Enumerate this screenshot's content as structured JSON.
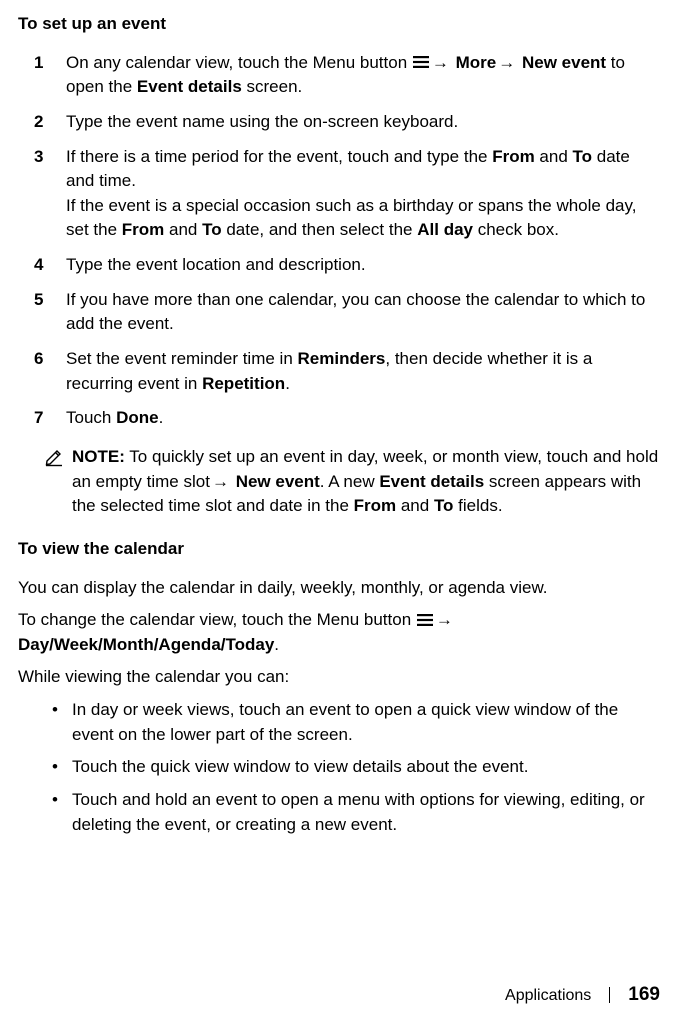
{
  "section1": {
    "heading": "To set up an event",
    "steps": [
      {
        "num": "1",
        "pre": "On any calendar view, touch the Menu button ",
        "arrow1": "→ ",
        "more": "More",
        "arrow2": "→ ",
        "newevent": "New event",
        "mid": " to open the ",
        "eventdetails": "Event details",
        "post": " screen."
      },
      {
        "num": "2",
        "text": "Type the event name using the on-screen keyboard."
      },
      {
        "num": "3",
        "p1a": "If there is a time period for the event, touch and type the ",
        "from": "From",
        "p1b": " and ",
        "to": "To",
        "p1c": " date and time.",
        "p2a": "If the event is a special occasion such as a birthday or spans the whole day, set the ",
        "from2": "From",
        "p2b": " and ",
        "to2": "To",
        "p2c": " date, and then select the ",
        "allday": "All day",
        "p2d": " check box."
      },
      {
        "num": "4",
        "text": "Type the event location and description."
      },
      {
        "num": "5",
        "text": "If you have more than one calendar, you can choose the calendar to which to add the event."
      },
      {
        "num": "6",
        "a": "Set the event reminder time in ",
        "reminders": "Reminders",
        "b": ", then decide whether it is a recurring event in ",
        "repetition": "Repetition",
        "c": "."
      },
      {
        "num": "7",
        "a": "Touch ",
        "done": "Done",
        "b": "."
      }
    ],
    "note": {
      "label": "NOTE:",
      "a": " To quickly set up an event in day, week, or month view, touch and hold an empty time slot",
      "arrow": "→ ",
      "newevent": "New event",
      "b": ". A new ",
      "eventdetails": "Event details",
      "c": " screen appears with the selected time slot and date in the ",
      "from": "From",
      "d": " and ",
      "to": "To",
      "e": " fields."
    }
  },
  "section2": {
    "heading": "To view the calendar",
    "p1": "You can display the calendar in daily, weekly, monthly, or agenda view.",
    "p2a": "To change the calendar view, touch the Menu button ",
    "p2arrow": "→ ",
    "p2b": "Day/Week/Month/Agenda/Today",
    "p2c": ".",
    "p3": "While viewing the calendar you can:",
    "bullets": [
      "In day or week views, touch an event to open a quick view window of the event on the lower part of the screen.",
      "Touch the quick view window to view details about the event.",
      "Touch and hold an event to open a menu with options for viewing, editing, or deleting the event, or creating a new event."
    ]
  },
  "footer": {
    "section": "Applications",
    "page": "169"
  }
}
